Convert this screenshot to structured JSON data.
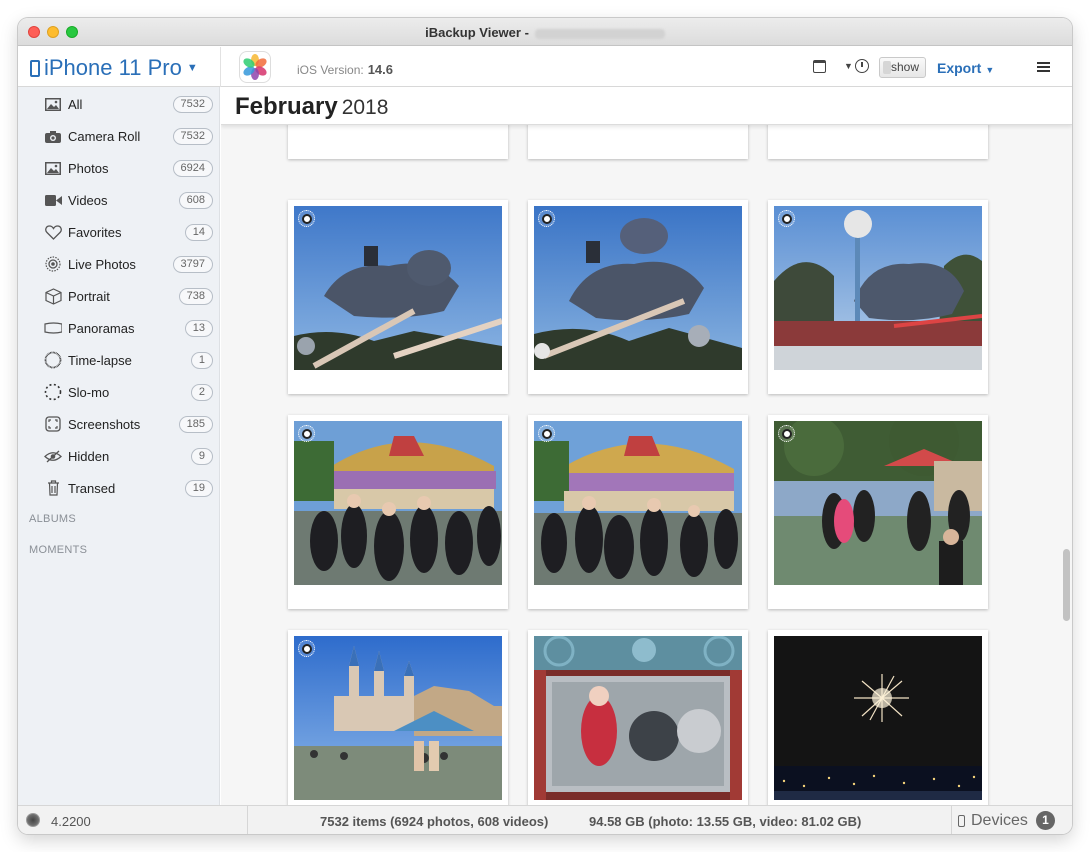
{
  "window": {
    "title": "iBackup Viewer -"
  },
  "toolbar": {
    "device_name": "iPhone 11 Pro",
    "ios_label": "iOS Version:",
    "ios_version": "14.6",
    "show_label": "show",
    "export_label": "Export"
  },
  "sidebar": {
    "items": [
      {
        "label": "All",
        "count": "7532",
        "icon": "photo-icon"
      },
      {
        "label": "Camera Roll",
        "count": "7532",
        "icon": "camera-icon"
      },
      {
        "label": "Photos",
        "count": "6924",
        "icon": "photo-icon"
      },
      {
        "label": "Videos",
        "count": "608",
        "icon": "video-icon"
      },
      {
        "label": "Favorites",
        "count": "14",
        "icon": "heart-icon"
      },
      {
        "label": "Live Photos",
        "count": "3797",
        "icon": "live-photo-icon"
      },
      {
        "label": "Portrait",
        "count": "738",
        "icon": "cube-icon"
      },
      {
        "label": "Panoramas",
        "count": "13",
        "icon": "panorama-icon"
      },
      {
        "label": "Time-lapse",
        "count": "1",
        "icon": "timelapse-icon"
      },
      {
        "label": "Slo-mo",
        "count": "2",
        "icon": "slomo-icon"
      },
      {
        "label": "Screenshots",
        "count": "185",
        "icon": "screenshot-icon"
      },
      {
        "label": "Hidden",
        "count": "9",
        "icon": "hidden-eye-icon"
      },
      {
        "label": "Transed",
        "count": "19",
        "icon": "trash-icon"
      }
    ],
    "albums_heading": "ALBUMS",
    "moments_heading": "MOMENTS"
  },
  "main": {
    "month": "February",
    "year": "2018",
    "photos": [
      {
        "live": true,
        "scene": "dumbo-ride"
      },
      {
        "live": true,
        "scene": "dumbo-ride"
      },
      {
        "live": true,
        "scene": "dumbo-ride-lamp"
      },
      {
        "live": true,
        "scene": "carousel-crowd"
      },
      {
        "live": true,
        "scene": "carousel-crowd"
      },
      {
        "live": true,
        "scene": "park-crowd"
      },
      {
        "live": true,
        "scene": "castle"
      },
      {
        "live": false,
        "scene": "shop-window"
      },
      {
        "live": false,
        "scene": "fireworks"
      }
    ]
  },
  "status": {
    "version": "4.2200",
    "items_summary": "7532 items (6924 photos, 608 videos)",
    "size_summary": "94.58 GB (photo: 13.55 GB, video: 81.02 GB)",
    "devices_label": "Devices",
    "devices_count": "1"
  },
  "colors": {
    "accent": "#2a6fb8",
    "sidebar_bg": "#eef1f5"
  }
}
